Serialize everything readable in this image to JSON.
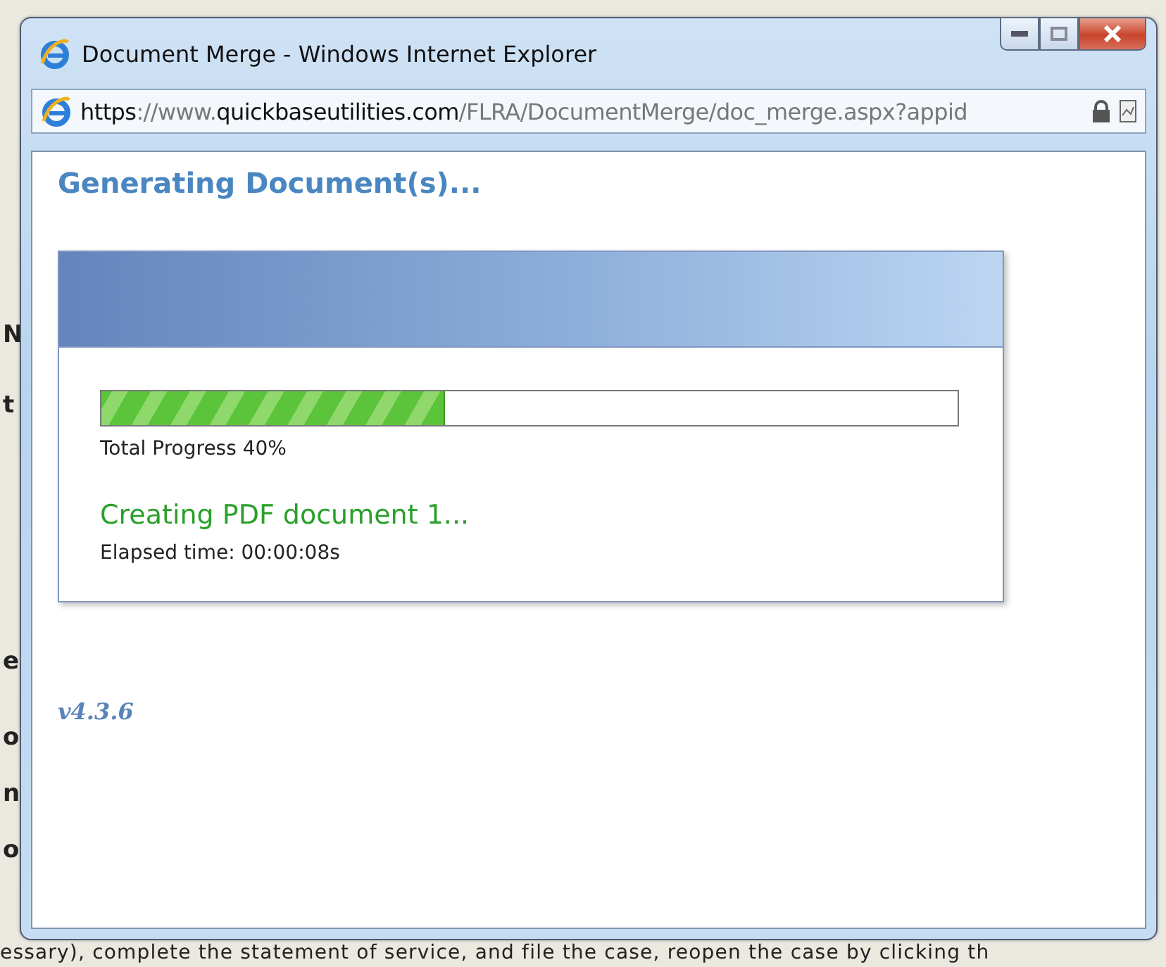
{
  "background_page": {
    "fragments": [
      "N",
      "t",
      "e",
      "o",
      "n",
      "o"
    ],
    "footer_text": "essary), complete the statement of service, and file the case, reopen the case by clicking th"
  },
  "window": {
    "title": "Document Merge - Windows Internet Explorer",
    "address": {
      "scheme": "https",
      "separator": "://www.",
      "domain": "quickbaseutilities.com",
      "path": "/FLRA/DocumentMerge/doc_merge.aspx?appid"
    }
  },
  "heading": "Generating Document(s)...",
  "progress": {
    "level": 0.4,
    "label": "Total Progress 40%"
  },
  "status": "Creating PDF document 1...",
  "elapsed": "Elapsed time: 00:00:08s",
  "version": "v4.3.6"
}
